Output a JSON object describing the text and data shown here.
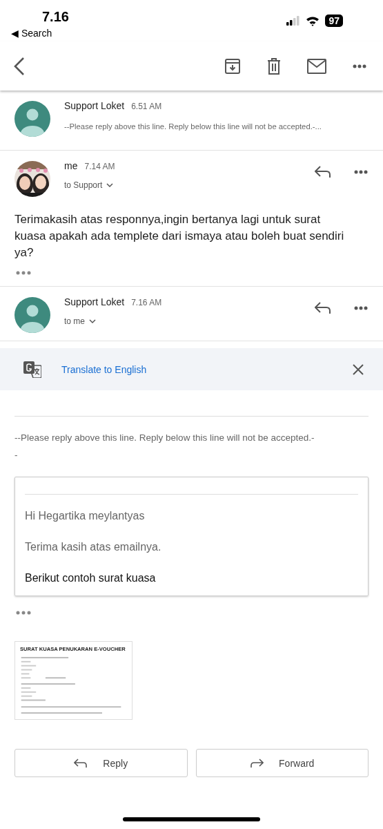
{
  "status_bar": {
    "time": "7.16",
    "back_link": "◀ Search",
    "battery": "97"
  },
  "messages": [
    {
      "sender": "Support Loket",
      "time": "6.51 AM",
      "expanded": false,
      "kind": "default_avatar",
      "snippet": "--Please reply above this line. Reply below this line will not be accepted.-..."
    },
    {
      "sender": "me",
      "time": "7.14 AM",
      "expanded": true,
      "kind": "photo_avatar",
      "recipient": "to Support",
      "body": "Terimakasih atas responnya,ingin bertanya lagi untuk surat kuasa apakah ada templete dari ismaya atau boleh buat sendiri ya?",
      "trimmed": true
    },
    {
      "sender": "Support Loket",
      "time": "7.16 AM",
      "expanded": true,
      "kind": "default_avatar",
      "recipient": "to me"
    }
  ],
  "translate": {
    "label": "Translate to English"
  },
  "email_body": {
    "intro_lines": [
      "--Please reply above this line. Reply below this line will not be accepted.-",
      "-"
    ],
    "quote_lines": [
      {
        "text": "Hi Hegartika meylantyas",
        "emphasis": false
      },
      {
        "text": "Terima kasih atas emailnya.",
        "emphasis": false
      },
      {
        "text": "Berikut contoh surat kuasa",
        "emphasis": true
      }
    ],
    "trimmed": true
  },
  "attachment": {
    "title": "SURAT KUASA PENUKARAN E-VOUCHER"
  },
  "actions": [
    {
      "label": "Reply",
      "kind": "reply"
    },
    {
      "label": "Forward",
      "kind": "forward"
    }
  ]
}
